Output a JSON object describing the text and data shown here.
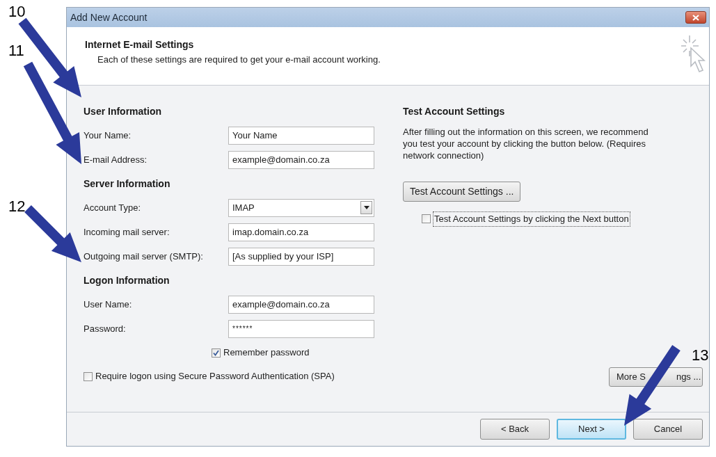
{
  "window": {
    "title": "Add New Account"
  },
  "header": {
    "title": "Internet E-mail Settings",
    "subtitle": "Each of these settings are required to get your e-mail account working."
  },
  "sections": [
    {
      "heading": "User Information",
      "fields": [
        {
          "label": "Your Name:",
          "value": "Your Name",
          "kind": "text"
        },
        {
          "label": "E-mail Address:",
          "value": "example@domain.co.za",
          "kind": "text"
        }
      ]
    },
    {
      "heading": "Server Information",
      "fields": [
        {
          "label": "Account Type:",
          "value": "IMAP",
          "kind": "dropdown"
        },
        {
          "label": "Incoming mail server:",
          "value": "imap.domain.co.za",
          "kind": "text"
        },
        {
          "label": "Outgoing mail server (SMTP):",
          "value": "[As supplied by your ISP]",
          "kind": "text"
        }
      ]
    },
    {
      "heading": "Logon Information",
      "fields": [
        {
          "label": "User Name:",
          "value": "example@domain.co.za",
          "kind": "text"
        },
        {
          "label": "Password:",
          "value": "******",
          "kind": "password"
        }
      ]
    }
  ],
  "remember_password": {
    "label": "Remember password",
    "checked": true
  },
  "require_spa": {
    "label": "Require logon using Secure Password Authentication (SPA)",
    "checked": false
  },
  "test_settings": {
    "heading": "Test Account Settings",
    "description": "After filling out the information on this screen, we recommend you test your account by clicking the button below. (Requires network connection)",
    "button": "Test Account Settings ...",
    "auto_test": {
      "label": "Test Account Settings by clicking the Next button",
      "checked": false
    }
  },
  "more_settings_button": {
    "label_parts": [
      "More S",
      "ngs ..."
    ]
  },
  "buttons": [
    {
      "label": "< Back",
      "default": false
    },
    {
      "label": "Next >",
      "default": true
    },
    {
      "label": "Cancel",
      "default": false
    }
  ],
  "annotations": [
    {
      "number": "10"
    },
    {
      "number": "11"
    },
    {
      "number": "12"
    },
    {
      "number": "13"
    }
  ]
}
